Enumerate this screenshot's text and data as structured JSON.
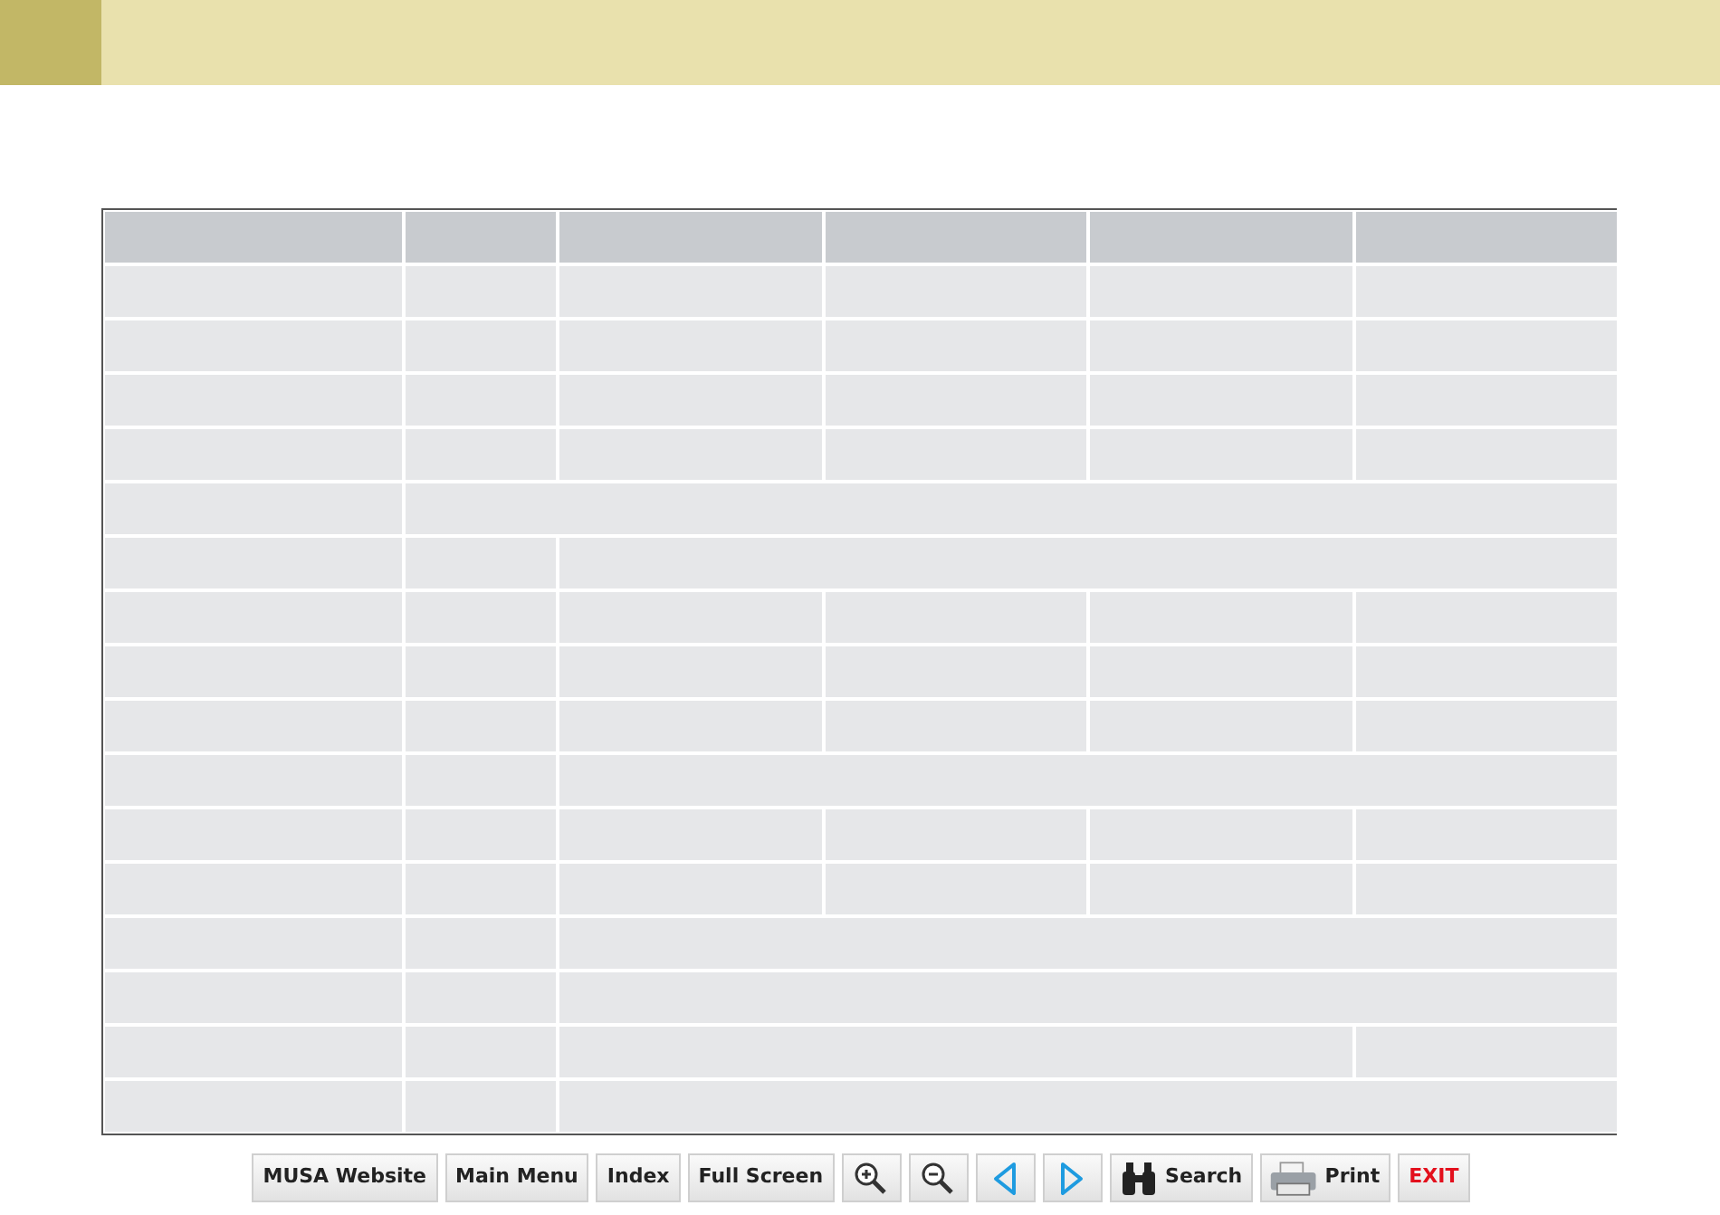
{
  "header_bar": {
    "kind": "banner"
  },
  "table": {
    "rows": [
      {
        "kind": "header"
      },
      {
        "kind": "full"
      },
      {
        "kind": "full"
      },
      {
        "kind": "full"
      },
      {
        "kind": "full"
      },
      {
        "kind": "span_after_1"
      },
      {
        "kind": "span_after_2"
      },
      {
        "kind": "full"
      },
      {
        "kind": "full"
      },
      {
        "kind": "full"
      },
      {
        "kind": "span_after_2"
      },
      {
        "kind": "full"
      },
      {
        "kind": "full"
      },
      {
        "kind": "span_after_2"
      },
      {
        "kind": "span_after_2"
      },
      {
        "kind": "span_middle"
      },
      {
        "kind": "span_after_2"
      }
    ]
  },
  "toolbar": [
    {
      "kind": "text",
      "label": "MUSA Website"
    },
    {
      "kind": "text",
      "label": "Main Menu"
    },
    {
      "kind": "text",
      "label": "Index"
    },
    {
      "kind": "text",
      "label": "Full Screen"
    },
    {
      "kind": "zoom_in"
    },
    {
      "kind": "zoom_out"
    },
    {
      "kind": "previous"
    },
    {
      "kind": "next"
    },
    {
      "kind": "search",
      "label": "Search"
    },
    {
      "kind": "print",
      "label": "Print"
    },
    {
      "kind": "exit",
      "label": "EXIT"
    }
  ]
}
